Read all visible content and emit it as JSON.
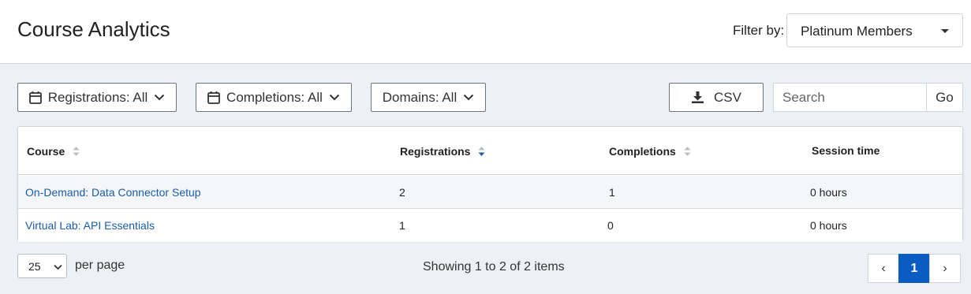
{
  "header": {
    "title": "Course Analytics",
    "filter_label": "Filter by:",
    "filter_value": "Platinum Members"
  },
  "toolbar": {
    "registrations_label": "Registrations: All",
    "completions_label": "Completions: All",
    "domains_label": "Domains: All",
    "csv_label": "CSV",
    "search_placeholder": "Search",
    "go_label": "Go"
  },
  "table": {
    "columns": [
      "Course",
      "Registrations",
      "Completions",
      "Session time"
    ],
    "sorted_column": "Registrations",
    "rows": [
      {
        "course": "On-Demand: Data Connector Setup",
        "registrations": "2",
        "completions": "1",
        "session_time": "0 hours"
      },
      {
        "course": "Virtual Lab: API Essentials",
        "registrations": "1",
        "completions": "0",
        "session_time": "0 hours"
      }
    ]
  },
  "footer": {
    "per_page_value": "25",
    "per_page_label": "per page",
    "showing_text": "Showing 1 to 2 of 2 items",
    "pagination": {
      "prev": "‹",
      "current": "1",
      "next": "›"
    }
  },
  "icons": {
    "registrations": "calendar-icon",
    "completions": "calendar-icon",
    "csv": "download-icon",
    "dropdown": "chevron-down-icon",
    "sort": "sort-icon"
  },
  "colors": {
    "accent": "#0a5cc2",
    "link": "#1a5ca8",
    "background": "#edf0f5"
  }
}
